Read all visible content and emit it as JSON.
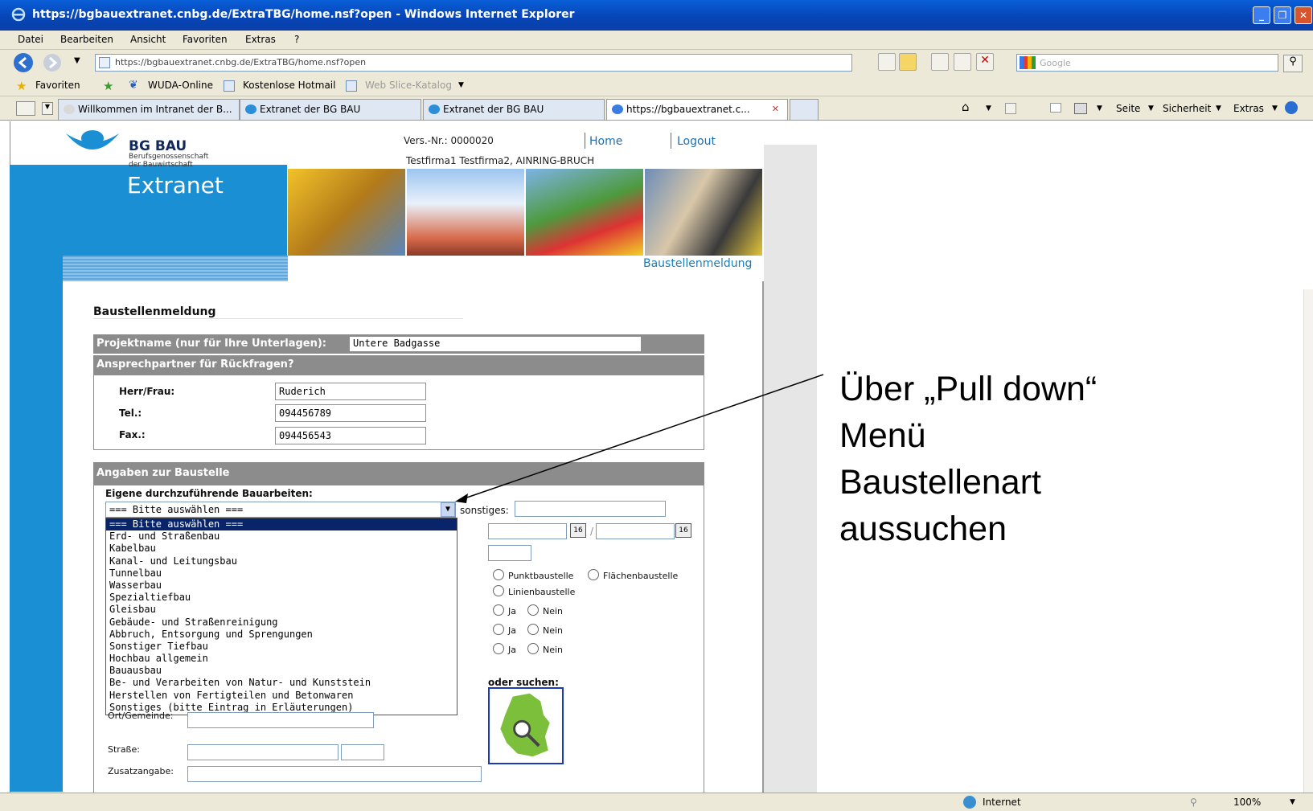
{
  "window": {
    "title": "https://bgbauextranet.cnbg.de/ExtraTBG/home.nsf?open - Windows Internet Explorer"
  },
  "menu": [
    "Datei",
    "Bearbeiten",
    "Ansicht",
    "Favoriten",
    "Extras",
    "?"
  ],
  "address": {
    "url": "https://bgbauextranet.cnbg.de/ExtraTBG/home.nsf?open"
  },
  "search": {
    "placeholder": "Google"
  },
  "favorites": {
    "label": "Favoriten",
    "items": [
      "WUDA-Online",
      "Kostenlose Hotmail",
      "Web Slice-Katalog"
    ]
  },
  "tabs": [
    "Willkommen im Intranet der B...",
    "Extranet der BG BAU",
    "Extranet der BG BAU",
    "https://bgbauextranet.c..."
  ],
  "commands": [
    "Seite",
    "Sicherheit",
    "Extras"
  ],
  "header": {
    "brand": "BG BAU",
    "brand_sub1": "Berufsgenossenschaft",
    "brand_sub2": "der Bauwirtschaft",
    "app": "Extranet",
    "vers": "Vers.-Nr.: 0000020",
    "home": "Home",
    "logout": "Logout",
    "firm": "Testfirma1 Testfirma2, AINRING-BRUCH",
    "crumb": "Baustellenmeldung"
  },
  "form": {
    "title": "Baustellenmeldung",
    "projekt_label": "Projektname (nur für Ihre Unterlagen):",
    "projekt_value": "Untere Badgasse",
    "ansprech_header": "Ansprechpartner für Rückfragen?",
    "herr_label": "Herr/Frau:",
    "herr_value": "Ruderich",
    "tel_label": "Tel.:",
    "tel_value": "094456789",
    "fax_label": "Fax.:",
    "fax_value": "094456543",
    "baustelle_header": "Angaben zur Baustelle",
    "eigene_label": "Eigene durchzuführende Bauarbeiten:",
    "select_value": "=== Bitte auswählen ===",
    "sonstiges_label": "sonstiges:",
    "options": [
      "=== Bitte auswählen ===",
      "Erd- und Straßenbau",
      "Kabelbau",
      "Kanal- und Leitungsbau",
      "Tunnelbau",
      "Wasserbau",
      "Spezialtiefbau",
      "Gleisbau",
      "Gebäude- und Straßenreinigung",
      "Abbruch, Entsorgung und Sprengungen",
      "Sonstiger Tiefbau",
      "Hochbau allgemein",
      "Bauausbau",
      "Be- und Verarbeiten von Natur- und Kunststein",
      "Herstellen von Fertigteilen und Betonwaren",
      "Sonstiges (bitte Eintrag in Erläuterungen)"
    ],
    "punkt": "Punktbaustelle",
    "flaeche": "Flächenbaustelle",
    "linie": "Linienbaustelle",
    "ja": "Ja",
    "nein": "Nein",
    "oder_suchen": "oder suchen:",
    "ort_label": "Ort/Gemeinde:",
    "strasse_label": "Straße:",
    "zusatz_label": "Zusatzangabe:",
    "cal_icon": "16"
  },
  "annotation": [
    "Über „Pull down“",
    "Menü",
    "Baustellenart",
    "aussuchen"
  ],
  "status": {
    "zone": "Internet",
    "zoom": "100%"
  }
}
